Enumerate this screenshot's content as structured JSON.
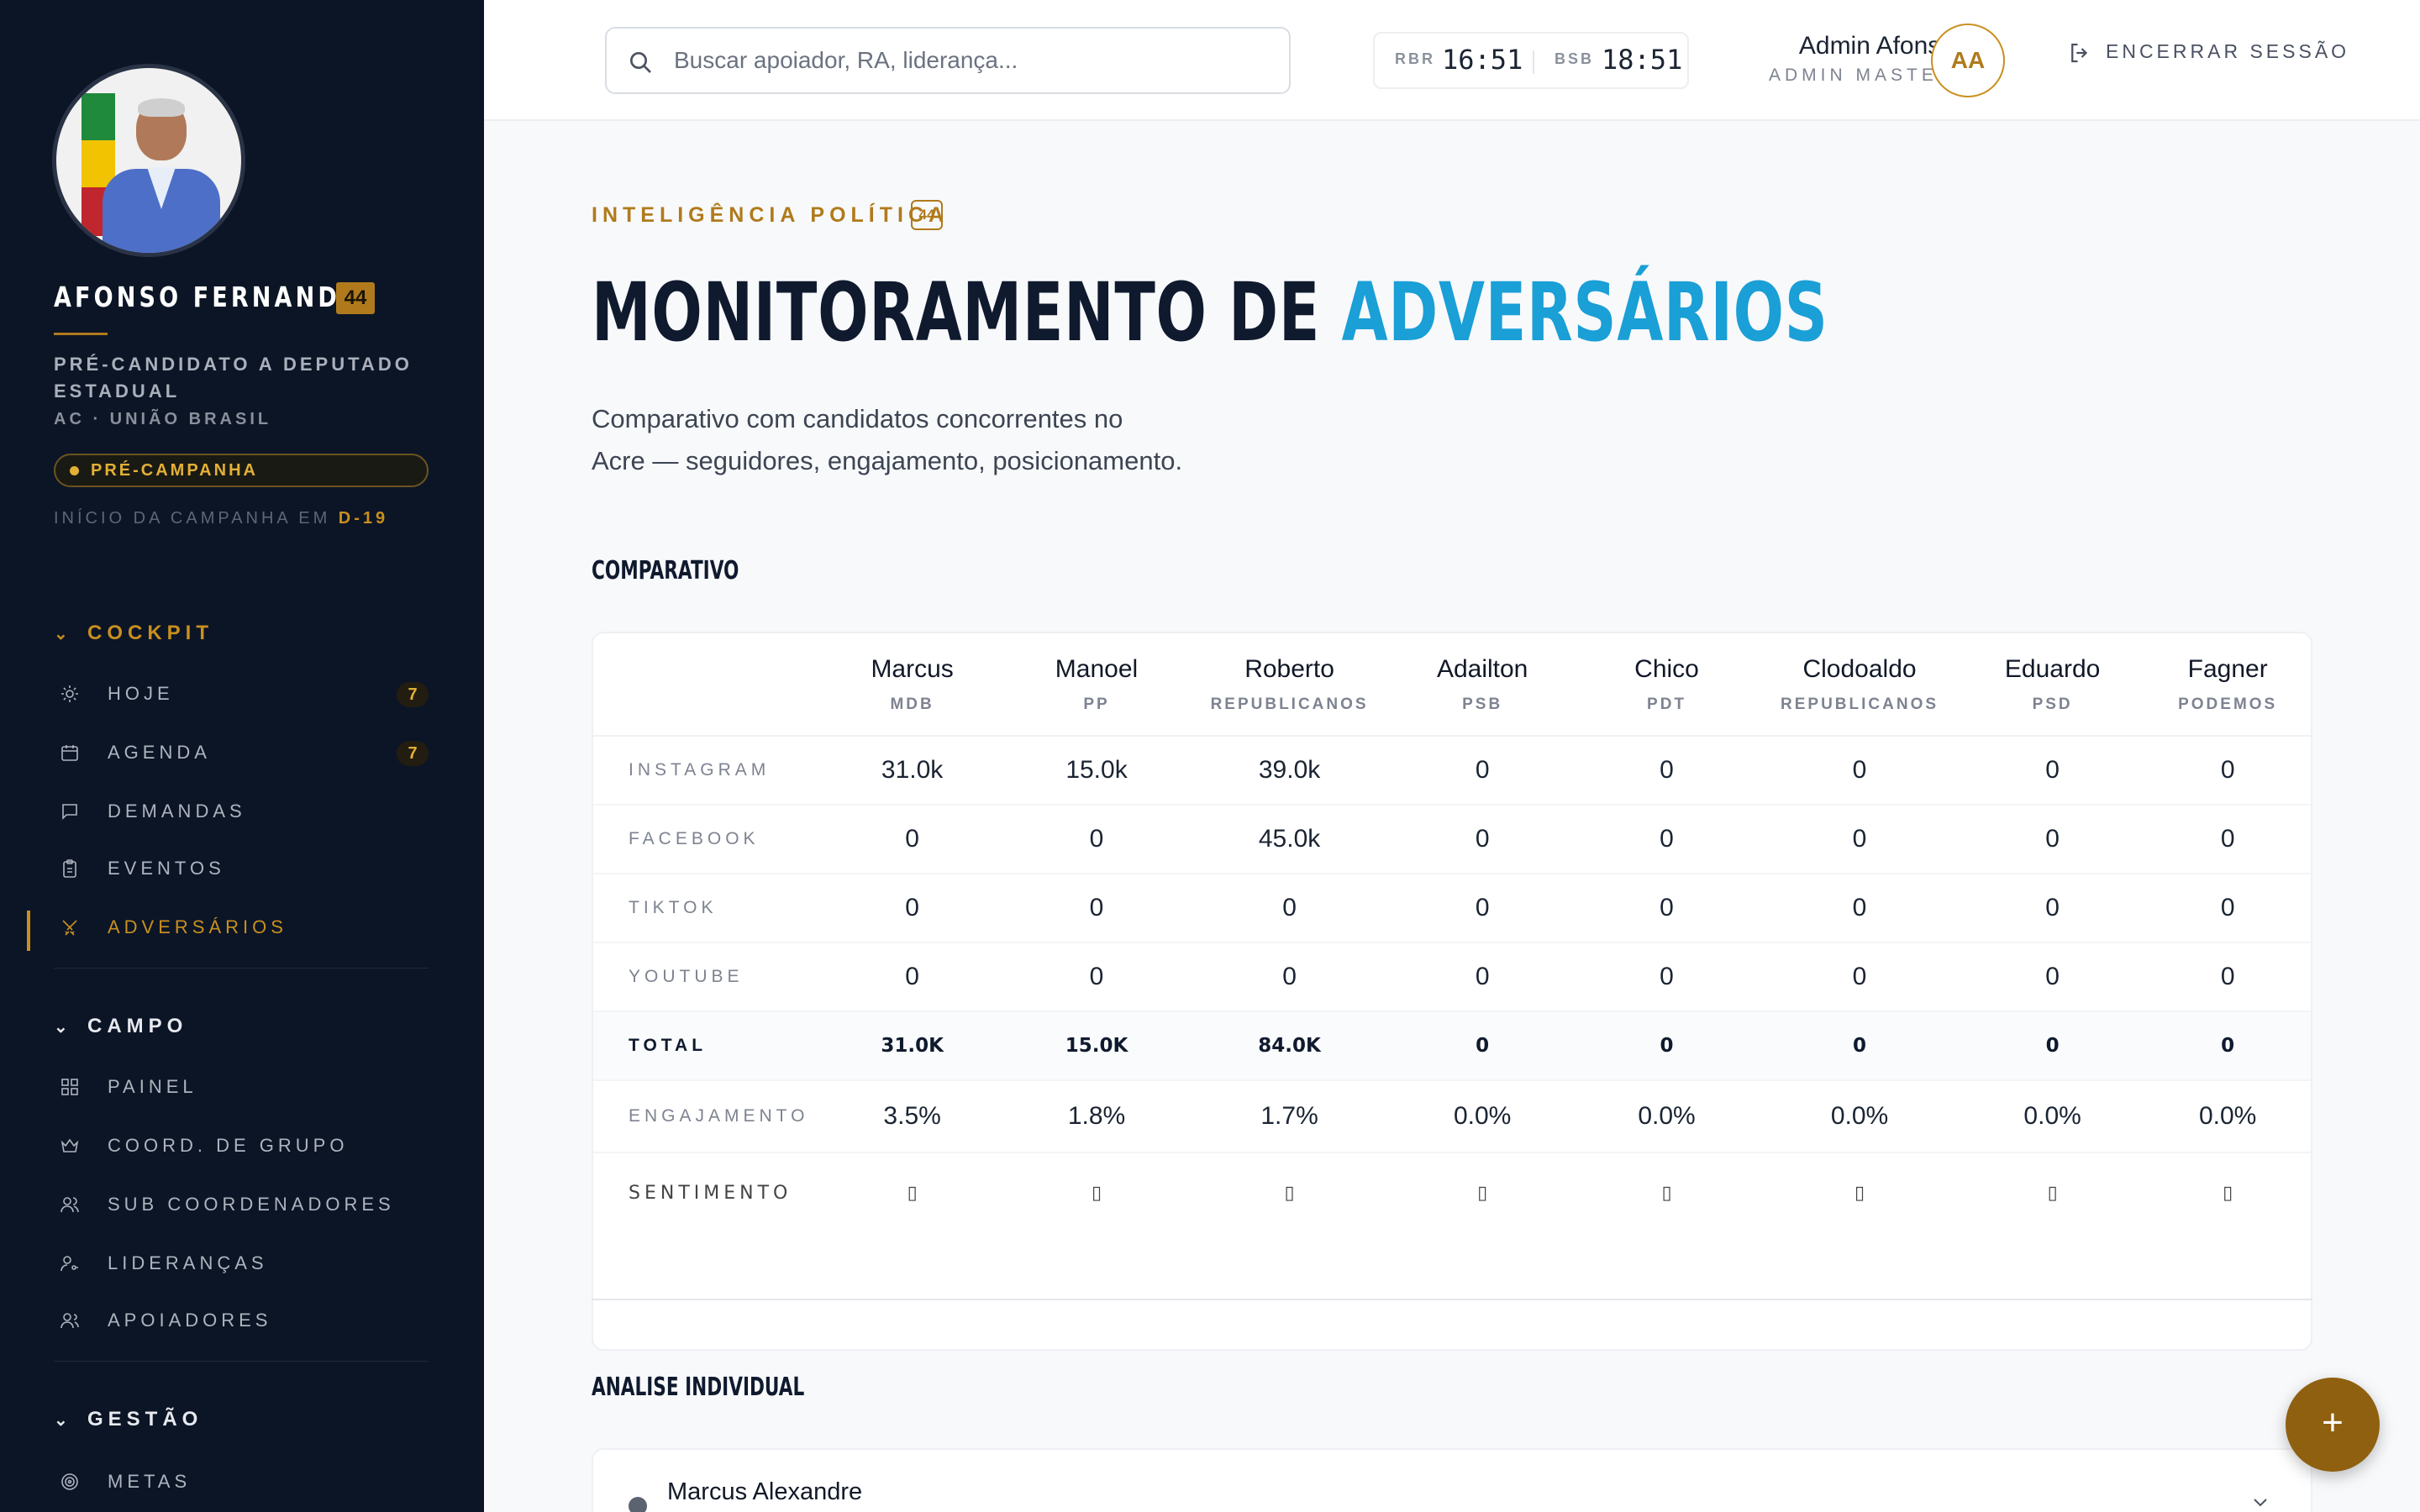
{
  "candidate": {
    "name": "AFONSO FERNANDES",
    "number": "44",
    "role": "PRÉ-CANDIDATO A DEPUTADO ESTADUAL",
    "party": "AC · UNIÃO BRASIL",
    "status": "PRÉ-CAMPANHA",
    "campaign_start_prefix": "INÍCIO DA CAMPANHA EM",
    "campaign_start_value": "D-19"
  },
  "sidebar": {
    "sections": [
      {
        "title": "COCKPIT",
        "items": [
          {
            "label": "HOJE",
            "icon": "sun-icon",
            "badge": "7"
          },
          {
            "label": "AGENDA",
            "icon": "calendar-icon",
            "badge": "7"
          },
          {
            "label": "DEMANDAS",
            "icon": "chat-icon"
          },
          {
            "label": "EVENTOS",
            "icon": "clipboard-icon"
          },
          {
            "label": "ADVERSÁRIOS",
            "icon": "swords-icon",
            "active": true
          }
        ]
      },
      {
        "title": "CAMPO",
        "items": [
          {
            "label": "PAINEL",
            "icon": "grid-icon"
          },
          {
            "label": "COORD. DE GRUPO",
            "icon": "crown-icon"
          },
          {
            "label": "SUB COORDENADORES",
            "icon": "users-icon"
          },
          {
            "label": "LIDERANÇAS",
            "icon": "user-key-icon"
          },
          {
            "label": "APOIADORES",
            "icon": "user-group-icon"
          }
        ]
      },
      {
        "title": "GESTÃO",
        "items": [
          {
            "label": "METAS",
            "icon": "target-icon"
          }
        ]
      }
    ]
  },
  "topbar": {
    "search_placeholder": "Buscar apoiador, RA, liderança...",
    "clocks": [
      {
        "label": "RBR",
        "time": "16:51"
      },
      {
        "label": "BSB",
        "time": "18:51"
      }
    ],
    "user_name": "Admin Afonso",
    "user_role": "ADMIN MASTER",
    "user_initials": "AA",
    "logout_label": "ENCERRAR SESSÃO"
  },
  "page": {
    "eyebrow": "INTELIGÊNCIA POLÍTICA",
    "eyebrow_badge": "44",
    "title_main": "MONITORAMENTO DE",
    "title_highlight": "ADVERSÁRIOS",
    "subtitle_line1": "Comparativo com candidatos concorrentes no",
    "subtitle_line2": "Acre — seguidores, engajamento, posicionamento.",
    "comparison_label": "COMPARATIVO",
    "individual_label": "ANALISE INDIVIDUAL"
  },
  "comparison": {
    "columns": [
      {
        "name": "Marcus",
        "party": "MDB"
      },
      {
        "name": "Manoel",
        "party": "PP"
      },
      {
        "name": "Roberto",
        "party": "REPUBLICANOS"
      },
      {
        "name": "Adailton",
        "party": "PSB"
      },
      {
        "name": "Chico",
        "party": "PDT"
      },
      {
        "name": "Clodoaldo",
        "party": "REPUBLICANOS"
      },
      {
        "name": "Eduardo",
        "party": "PSD"
      },
      {
        "name": "Fagner",
        "party": "PODEMOS"
      }
    ],
    "rows": [
      {
        "label": "INSTAGRAM",
        "kind": "normal",
        "values": [
          "31.0k",
          "15.0k",
          "39.0k",
          "0",
          "0",
          "0",
          "0",
          "0"
        ]
      },
      {
        "label": "FACEBOOK",
        "kind": "normal",
        "values": [
          "0",
          "0",
          "45.0k",
          "0",
          "0",
          "0",
          "0",
          "0"
        ]
      },
      {
        "label": "TIKTOK",
        "kind": "normal",
        "values": [
          "0",
          "0",
          "0",
          "0",
          "0",
          "0",
          "0",
          "0"
        ]
      },
      {
        "label": "YOUTUBE",
        "kind": "normal",
        "values": [
          "0",
          "0",
          "0",
          "0",
          "0",
          "0",
          "0",
          "0"
        ]
      },
      {
        "label": "TOTAL",
        "kind": "total",
        "values": [
          "31.0K",
          "15.0K",
          "84.0K",
          "0",
          "0",
          "0",
          "0",
          "0"
        ]
      },
      {
        "label": "ENGAJAMENTO",
        "kind": "engage",
        "values": [
          "3.5%",
          "1.8%",
          "1.7%",
          "0.0%",
          "0.0%",
          "0.0%",
          "0.0%",
          "0.0%"
        ]
      },
      {
        "label": "SENTIMENTO",
        "kind": "sent",
        "values": [
          "▯",
          "▯",
          "▯",
          "▯",
          "▯",
          "▯",
          "▯",
          "▯"
        ]
      }
    ]
  },
  "individual": [
    {
      "name": "Marcus Alexandre"
    }
  ],
  "fab_label": "+"
}
